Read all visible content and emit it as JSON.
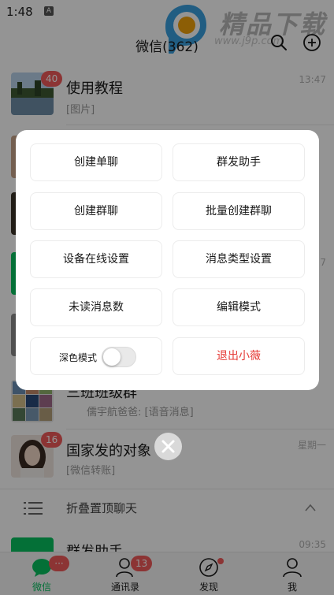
{
  "status_bar": {
    "time": "1:48",
    "app_icon_letter": "A"
  },
  "watermark": {
    "text": "精品下载",
    "url": "www.j9p.com"
  },
  "header": {
    "title": "微信(362)",
    "search_icon": "search-icon",
    "add_icon": "plus-circle-icon"
  },
  "chats": [
    {
      "name": "使用教程",
      "preview": "[图片]",
      "time": "13:47",
      "badge": "40"
    },
    {
      "name": "",
      "preview": "",
      "time": "",
      "badge": ""
    },
    {
      "name": "",
      "preview": "",
      "time": "",
      "badge": ""
    },
    {
      "name": "",
      "preview": "",
      "time": "7",
      "badge": ""
    },
    {
      "name": "",
      "preview": "",
      "time": "",
      "badge": ""
    },
    {
      "name": "三班班级群",
      "preview": "儒宇航爸爸: [语音消息]",
      "time": "",
      "badge": ""
    },
    {
      "name": "国家发的对象",
      "preview": "[微信转账]",
      "time": "星期一",
      "badge": "16"
    },
    {
      "name": "群发助手",
      "preview": "",
      "time": "09:35",
      "badge": ""
    }
  ],
  "fold": {
    "label": "折叠置顶聊天"
  },
  "modal": {
    "buttons": [
      {
        "label": "创建单聊"
      },
      {
        "label": "群发助手"
      },
      {
        "label": "创建群聊"
      },
      {
        "label": "批量创建群聊"
      },
      {
        "label": "设备在线设置"
      },
      {
        "label": "消息类型设置"
      },
      {
        "label": "未读消息数"
      },
      {
        "label": "编辑模式"
      }
    ],
    "dark_mode_label": "深色模式",
    "dark_mode_on": false,
    "exit_label": "退出小薇",
    "close_icon": "close-icon"
  },
  "tabs": [
    {
      "label": "微信",
      "badge": "···",
      "icon": "chat-bubble-icon",
      "active": true
    },
    {
      "label": "通讯录",
      "badge": "13",
      "icon": "contacts-icon",
      "active": false
    },
    {
      "label": "发现",
      "badge": "",
      "icon": "compass-icon",
      "active": false
    },
    {
      "label": "我",
      "badge": "",
      "icon": "person-icon",
      "active": false
    }
  ],
  "colors": {
    "accent_green": "#07c160",
    "badge_red": "#f25a5a",
    "danger": "#e53935"
  }
}
